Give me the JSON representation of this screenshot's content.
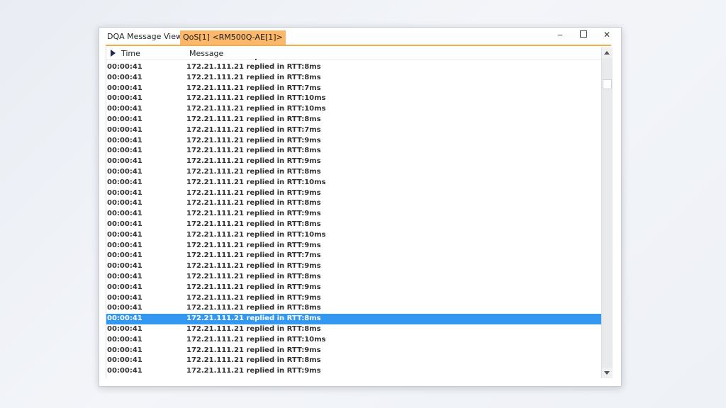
{
  "window": {
    "title": "DQA Message View:1",
    "active_tab": "QoS[1] <RM500Q-AE[1]>",
    "controls": {
      "minimize": "‒",
      "close": "✕"
    }
  },
  "table": {
    "columns": [
      "Time",
      "Message"
    ],
    "selected_index": 24,
    "rows": [
      {
        "time": "00:00:41",
        "message": "172.21.111.21 replied in RTT:8ms"
      },
      {
        "time": "00:00:41",
        "message": "172.21.111.21 replied in RTT:8ms"
      },
      {
        "time": "00:00:41",
        "message": "172.21.111.21 replied in RTT:7ms"
      },
      {
        "time": "00:00:41",
        "message": "172.21.111.21 replied in RTT:10ms"
      },
      {
        "time": "00:00:41",
        "message": "172.21.111.21 replied in RTT:10ms"
      },
      {
        "time": "00:00:41",
        "message": "172.21.111.21 replied in RTT:8ms"
      },
      {
        "time": "00:00:41",
        "message": "172.21.111.21 replied in RTT:7ms"
      },
      {
        "time": "00:00:41",
        "message": "172.21.111.21 replied in RTT:9ms"
      },
      {
        "time": "00:00:41",
        "message": "172.21.111.21 replied in RTT:8ms"
      },
      {
        "time": "00:00:41",
        "message": "172.21.111.21 replied in RTT:9ms"
      },
      {
        "time": "00:00:41",
        "message": "172.21.111.21 replied in RTT:8ms"
      },
      {
        "time": "00:00:41",
        "message": "172.21.111.21 replied in RTT:10ms"
      },
      {
        "time": "00:00:41",
        "message": "172.21.111.21 replied in RTT:9ms"
      },
      {
        "time": "00:00:41",
        "message": "172.21.111.21 replied in RTT:8ms"
      },
      {
        "time": "00:00:41",
        "message": "172.21.111.21 replied in RTT:9ms"
      },
      {
        "time": "00:00:41",
        "message": "172.21.111.21 replied in RTT:8ms"
      },
      {
        "time": "00:00:41",
        "message": "172.21.111.21 replied in RTT:10ms"
      },
      {
        "time": "00:00:41",
        "message": "172.21.111.21 replied in RTT:9ms"
      },
      {
        "time": "00:00:41",
        "message": "172.21.111.21 replied in RTT:7ms"
      },
      {
        "time": "00:00:41",
        "message": "172.21.111.21 replied in RTT:9ms"
      },
      {
        "time": "00:00:41",
        "message": "172.21.111.21 replied in RTT:8ms"
      },
      {
        "time": "00:00:41",
        "message": "172.21.111.21 replied in RTT:9ms"
      },
      {
        "time": "00:00:41",
        "message": "172.21.111.21 replied in RTT:9ms"
      },
      {
        "time": "00:00:41",
        "message": "172.21.111.21 replied in RTT:8ms"
      },
      {
        "time": "00:00:41",
        "message": "172.21.111.21 replied in RTT:8ms"
      },
      {
        "time": "00:00:41",
        "message": "172.21.111.21 replied in RTT:8ms"
      },
      {
        "time": "00:00:41",
        "message": "172.21.111.21 replied in RTT:10ms"
      },
      {
        "time": "00:00:41",
        "message": "172.21.111.21 replied in RTT:9ms"
      },
      {
        "time": "00:00:41",
        "message": "172.21.111.21 replied in RTT:8ms"
      },
      {
        "time": "00:00:41",
        "message": "172.21.111.21 replied in RTT:9ms"
      }
    ]
  },
  "colors": {
    "accent_orange": "#f7a94e",
    "tab_orange": "#fbb86a",
    "selection_blue": "#3399f0"
  },
  "icons": {
    "header_arrow": "play-arrow-icon",
    "scroll_up": "scroll-up-arrow-icon",
    "scroll_down": "scroll-down-arrow-icon"
  }
}
